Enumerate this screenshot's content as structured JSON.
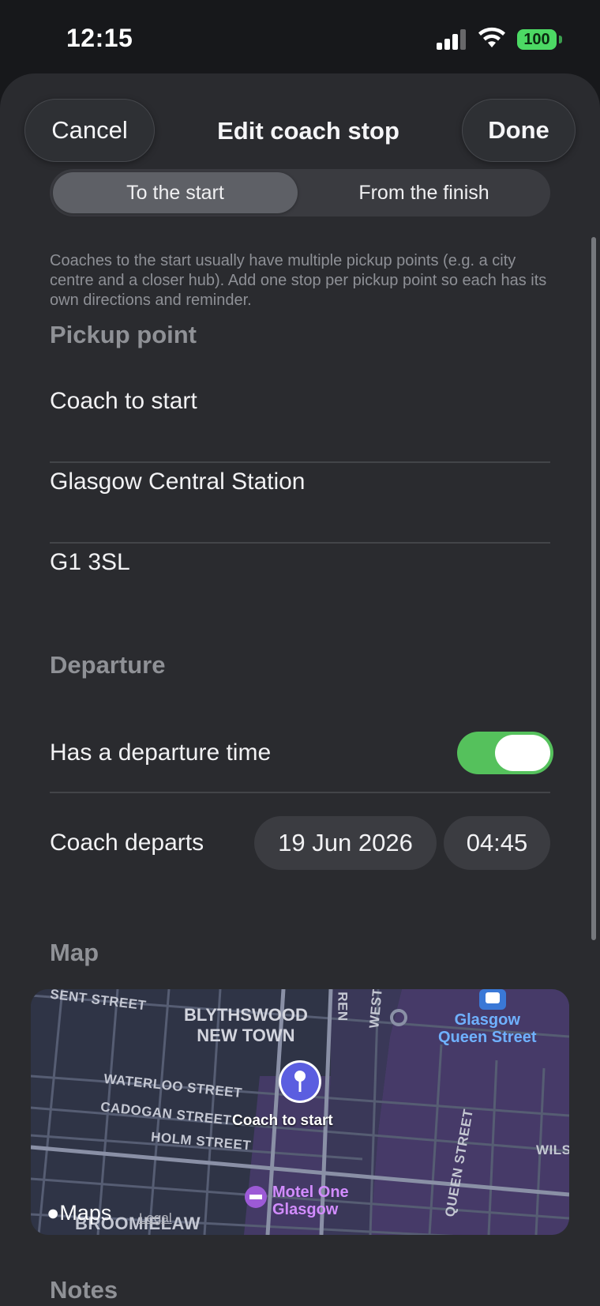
{
  "status_bar": {
    "time": "12:15",
    "battery": "100",
    "battery_color": "#4cd964"
  },
  "nav": {
    "cancel_label": "Cancel",
    "title": "Edit coach stop",
    "done_label": "Done"
  },
  "segmented": {
    "options": [
      {
        "label": "To the start",
        "selected": true
      },
      {
        "label": "From the finish",
        "selected": false
      }
    ]
  },
  "help_text": "Coaches to the start usually have multiple pickup points (e.g. a city centre and a closer hub). Add one stop per pickup point so each has its own directions and reminder.",
  "pickup": {
    "header": "Pickup point",
    "name": "Coach to start",
    "location": "Glasgow Central Station",
    "postcode": "G1 3SL"
  },
  "departure": {
    "header": "Departure",
    "has_time_label": "Has a departure time",
    "has_time_on": true,
    "toggle_color": "#55c15c",
    "departs_label": "Coach departs",
    "date": "19 Jun 2026",
    "time": "04:45"
  },
  "map": {
    "header": "Map",
    "streets": {
      "top": "SENT STREET",
      "waterloo": "WATERLOO STREET",
      "cadogan": "CADOGAN STREET",
      "holm": "HOLM STREET",
      "broomielaw": "BROOMIELAW",
      "queen": "QUEEN STREET",
      "wilson": "WILSO",
      "ren": "REN",
      "west": "WEST"
    },
    "area_line1": "BLYTHSWOOD",
    "area_line2": "NEW TOWN",
    "station_line1": "Glasgow",
    "station_line2": "Queen Street",
    "pin_label": "Coach to start",
    "hotel_line1": "Motel One",
    "hotel_line2": "Glasgow",
    "maps_brand": "Maps",
    "legal": "Legal"
  },
  "notes_header": "Notes"
}
